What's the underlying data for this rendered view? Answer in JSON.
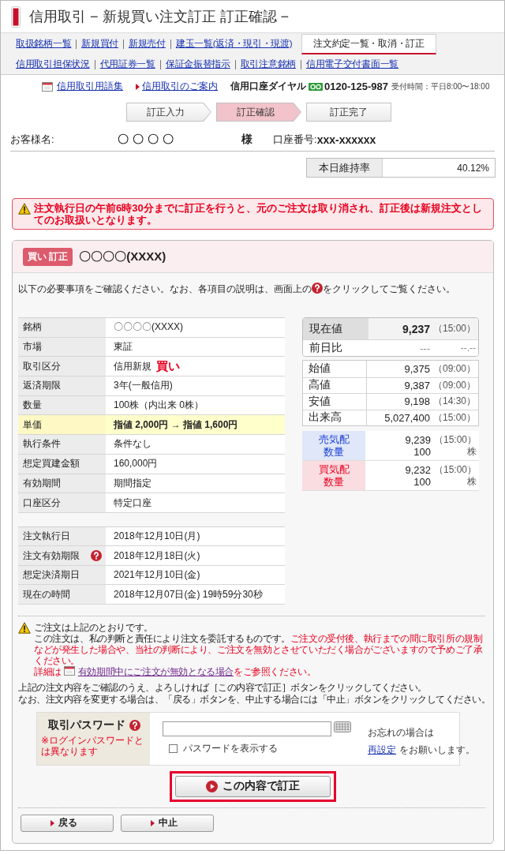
{
  "page_title": "信用取引 − 新規買い注文訂正 訂正確認 −",
  "nav": {
    "primary": [
      {
        "label": "取扱銘柄一覧",
        "selected": false
      },
      {
        "label": "新規買付",
        "selected": false
      },
      {
        "label": "新規売付",
        "selected": false
      },
      {
        "label": "建玉一覧(返済・現引・現渡)",
        "selected": false
      },
      {
        "label": "注文約定一覧・取消・訂正",
        "selected": true
      }
    ],
    "secondary": [
      "信用取引担保状況",
      "代用証券一覧",
      "保証金振替指示",
      "取引注意銘柄",
      "信用電子交付書面一覧"
    ]
  },
  "info_bar": {
    "links": [
      {
        "kind": "glossary",
        "label": "信用取引用語集"
      },
      {
        "kind": "guide",
        "label": "信用取引のご案内"
      }
    ],
    "dial_label": "信用口座ダイヤル",
    "phone": "0120-125-987",
    "hours": "受付時間：平日8:00〜18:00"
  },
  "steps": [
    {
      "label": "訂正入力",
      "selected": false
    },
    {
      "label": "訂正確認",
      "selected": true
    },
    {
      "label": "訂正完了",
      "selected": false
    }
  ],
  "customer": {
    "name_label": "お客様名:",
    "name": "〇〇〇〇",
    "honorific": "様",
    "account_label": "口座番号:",
    "account": "xxx-xxxxxx"
  },
  "maintenance_ratio": {
    "label": "本日維持率",
    "value": "40.12%"
  },
  "alert": "注文執行日の午前6時30分までに訂正を行うと、元のご注文は取り消され、訂正後は新規注文としてのお取扱いとなります。",
  "order": {
    "badge": "買い 訂正",
    "title": "〇〇〇〇(XXXX)",
    "instruction_before": "以下の必要事項をご確認ください。なお、各項目の説明は、画面上の",
    "instruction_after": "をクリックしてご覧ください。",
    "details": [
      {
        "label": "銘柄",
        "value": "〇〇〇〇(XXXX)",
        "highlighted": false
      },
      {
        "label": "市場",
        "value": "東証",
        "highlighted": false
      },
      {
        "label": "取引区分",
        "value": "信用新規",
        "side": "買い",
        "highlighted": false
      },
      {
        "label": "返済期限",
        "value": "3年(一般信用)",
        "highlighted": false
      },
      {
        "label": "数量",
        "value": "100株（内出来 0株）",
        "highlighted": false
      },
      {
        "label": "単価",
        "value": "指値 2,000円 → 指値 1,600円",
        "highlighted": true
      },
      {
        "label": "執行条件",
        "value": "条件なし",
        "highlighted": false
      },
      {
        "label": "想定買建金額",
        "value": "160,000円",
        "highlighted": false
      },
      {
        "label": "有効期間",
        "value": "期間指定",
        "highlighted": false
      },
      {
        "label": "口座区分",
        "value": "特定口座",
        "highlighted": false
      }
    ],
    "schedule": [
      {
        "label": "注文執行日",
        "value": "2018年12月10日(月)",
        "help": false
      },
      {
        "label": "注文有効期限",
        "value": "2018年12月18日(火)",
        "help": true
      },
      {
        "label": "想定決済期日",
        "value": "2021年12月10日(金)",
        "help": false
      },
      {
        "label": "現在の時間",
        "value": "2018年12月07日(金) 19時59分30秒",
        "help": false
      }
    ],
    "market": {
      "current": {
        "label": "現在値",
        "value": "9,237",
        "time": "（15:00）"
      },
      "change": {
        "label": "前日比",
        "value": "---",
        "percent": "--.--"
      },
      "ohlc": [
        {
          "label": "始値",
          "value": "9,375",
          "time": "（09:00）"
        },
        {
          "label": "高値",
          "value": "9,387",
          "time": "（09:00）"
        },
        {
          "label": "安値",
          "value": "9,198",
          "time": "（14:30）"
        },
        {
          "label": "出来高",
          "value": "5,027,400",
          "time": "（15:00）"
        }
      ],
      "quotes": [
        {
          "kind": "ask",
          "label": "売気配",
          "sub_label": "数量",
          "price": "9,239",
          "time": "（15:00）",
          "quantity": "100",
          "unit": "株"
        },
        {
          "kind": "bid",
          "label": "買気配",
          "sub_label": "数量",
          "price": "9,232",
          "time": "（15:00）",
          "quantity": "100",
          "unit": "株"
        }
      ]
    }
  },
  "notice": {
    "title": "ご注文は上記のとおりです。",
    "body": "この注文は、私の判断と責任により注文を委託するものです。",
    "caution": "ご注文の受付後、執行までの間に取引所の規制などが発生した場合や、当社の判断により、ご注文を無効とさせていただく場合がございますので予めご了承ください。",
    "detail_prefix": "詳細は",
    "detail_link": "有効期間中にご注文が無効となる場合",
    "detail_suffix": "をご参照ください。"
  },
  "guidance": [
    "上記の注文内容をご確認のうえ、よろしければ［この内容で訂正］ボタンをクリックしてください。",
    "なお、注文内容を変更する場合は、「戻る」ボタンを、中止する場合には「中止」ボタンをクリックしてください。"
  ],
  "password": {
    "label": "取引パスワード",
    "note": "※ログインパスワードとは異なります",
    "show_password": {
      "label": "パスワードを表示する",
      "checked": false
    },
    "forgot_lead": "お忘れの場合は",
    "forgot_link": "再設定",
    "forgot_after": "をお願いします。"
  },
  "actions": {
    "submit": {
      "label": "この内容で訂正",
      "highlighted": true
    },
    "back": "戻る",
    "cancel": "中止"
  }
}
